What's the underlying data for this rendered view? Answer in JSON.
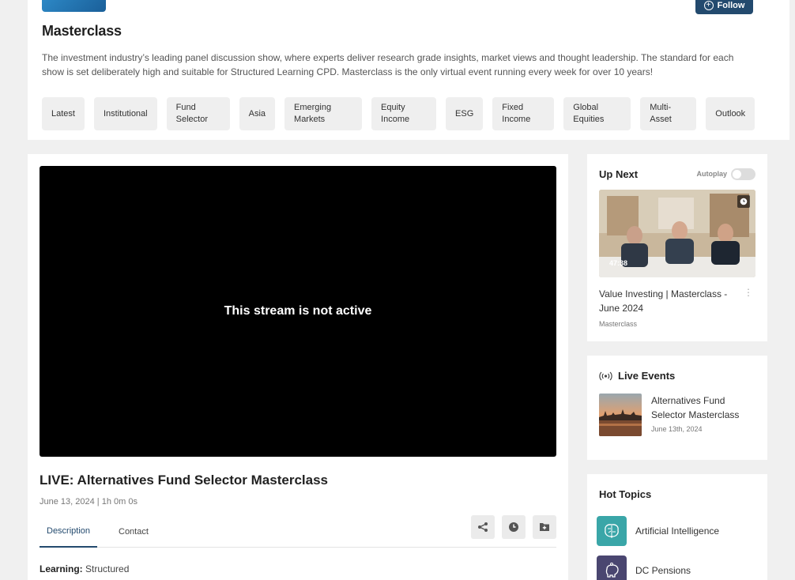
{
  "channel": {
    "title": "Masterclass",
    "follow_label": "Follow",
    "description": "The investment industry’s leading panel discussion show, where experts deliver research grade insights, market views and thought leadership. The standard for each show is set deliberately high and suitable for Structured Learning CPD. Masterclass is the only virtual event running every week for over 10 years!",
    "tags": [
      {
        "line1": "Latest",
        "line2": ""
      },
      {
        "line1": "Institutional",
        "line2": ""
      },
      {
        "line1": "Fund",
        "line2": "Selector"
      },
      {
        "line1": "Asia",
        "line2": ""
      },
      {
        "line1": "Emerging",
        "line2": "Markets"
      },
      {
        "line1": "Equity",
        "line2": "Income"
      },
      {
        "line1": "ESG",
        "line2": ""
      },
      {
        "line1": "Fixed",
        "line2": "Income"
      },
      {
        "line1": "Global",
        "line2": "Equities"
      },
      {
        "line1": "Multi-",
        "line2": "Asset"
      },
      {
        "line1": "Outlook",
        "line2": ""
      }
    ]
  },
  "video": {
    "status_message": "This stream is not active",
    "title": "LIVE: Alternatives Fund Selector Masterclass",
    "meta": "June 13, 2024 | 1h 0m 0s",
    "tabs": [
      "Description",
      "Contact"
    ],
    "active_tab": "Description",
    "actions": [
      "share-icon",
      "clock-icon",
      "add-folder-icon"
    ],
    "learning_label": "Learning:",
    "learning_value": "Structured"
  },
  "up_next": {
    "heading": "Up Next",
    "autoplay_label": "Autoplay",
    "autoplay_on": false,
    "item": {
      "duration": "47:38",
      "title": "Value Investing | Masterclass - June 2024",
      "channel": "Masterclass"
    }
  },
  "live_events": {
    "heading": "Live Events",
    "item": {
      "title": "Alternatives Fund Selector Masterclass",
      "date": "June 13th, 2024"
    }
  },
  "hot_topics": {
    "heading": "Hot Topics",
    "items": [
      {
        "label": "Artificial Intelligence",
        "icon": "brain-icon",
        "color": "#3aa6a8"
      },
      {
        "label": "DC Pensions",
        "icon": "piggy-bank-icon",
        "color": "#4a4670"
      }
    ]
  },
  "colors": {
    "accent": "#234a6e",
    "page_bg": "#f0f0f0"
  }
}
